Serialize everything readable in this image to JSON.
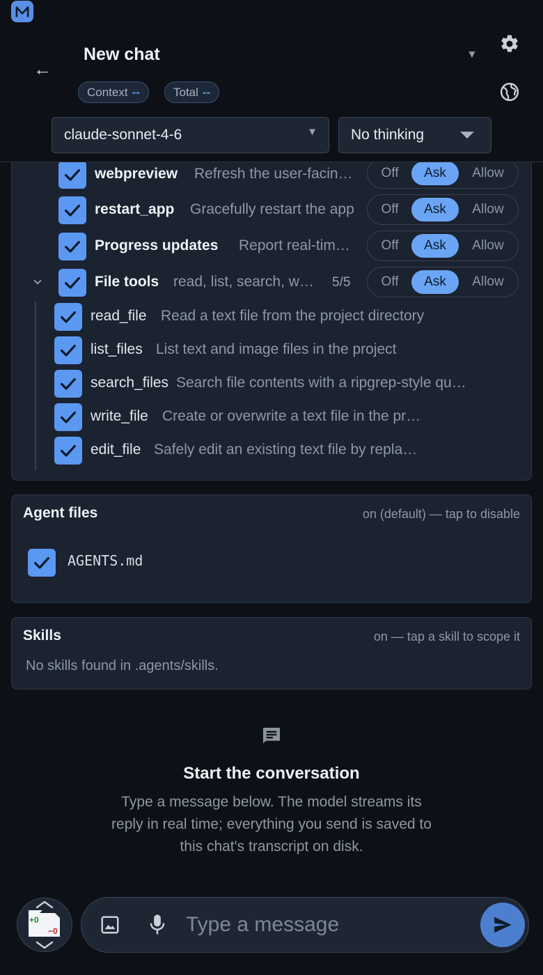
{
  "header": {
    "title": "New chat",
    "context_label": "Context",
    "context_value": "--",
    "total_label": "Total",
    "total_value": "--",
    "model": "claude-sonnet-4-6",
    "thinking": "No thinking"
  },
  "tools": {
    "segment_labels": {
      "off": "Off",
      "ask": "Ask",
      "allow": "Allow"
    },
    "rows": [
      {
        "name": "webpreview",
        "desc": "Refresh the user-facing preview",
        "mode": "Ask"
      },
      {
        "name": "restart_app",
        "desc": "Gracefully restart the app",
        "mode": "Ask"
      },
      {
        "name": "Progress updates",
        "desc": "Report real-time progress",
        "mode": "Ask"
      }
    ],
    "group": {
      "name": "File tools",
      "desc": "read, list, search, write, edit",
      "count": "5/5",
      "mode": "Ask",
      "items": [
        {
          "name": "read_file",
          "desc": "Read a text file from the project directory"
        },
        {
          "name": "list_files",
          "desc": "List text and image files in the project"
        },
        {
          "name": "search_files",
          "desc": "Search file contents with a ripgrep-style query"
        },
        {
          "name": "write_file",
          "desc": "Create or overwrite a text file in the project"
        },
        {
          "name": "edit_file",
          "desc": "Safely edit an existing text file by replacing text"
        }
      ]
    }
  },
  "agent_files": {
    "title": "Agent files",
    "hint": "on (default) — tap to disable",
    "file": "AGENTS.md"
  },
  "skills": {
    "title": "Skills",
    "hint": "on — tap a skill to scope it",
    "empty": "No skills found in .agents/skills."
  },
  "empty_state": {
    "title": "Start the conversation",
    "body": "Type a message below. The model streams its reply in real time; everything you send is saved to this chat's transcript on disk."
  },
  "composer": {
    "placeholder": "Type a message",
    "added": "+0",
    "removed": "−0"
  },
  "colors": {
    "accent": "#5b98f2",
    "background": "#0d1117",
    "card": "#1b2230"
  },
  "icons": [
    "app-logo",
    "back-arrow-icon",
    "chevron-down-icon",
    "gear-icon",
    "globe-icon",
    "checkmark-icon",
    "chat-bubble-icon",
    "image-icon",
    "microphone-icon",
    "send-icon",
    "file-diff-icon",
    "chevron-up-icon"
  ]
}
